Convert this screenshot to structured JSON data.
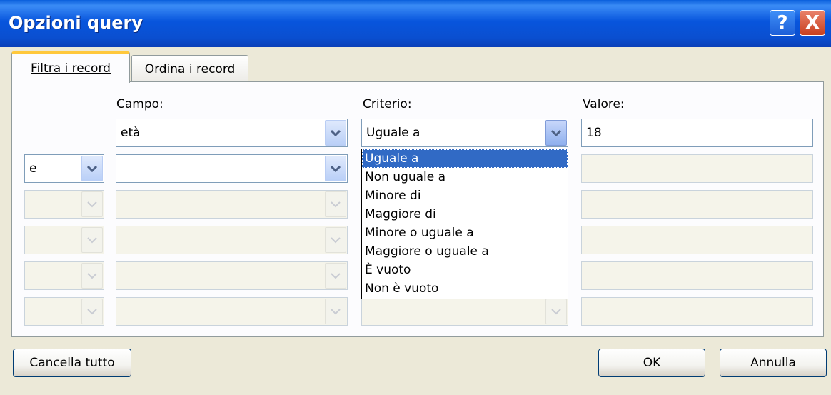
{
  "window": {
    "title": "Opzioni query",
    "help_icon": "?",
    "close_icon": "X"
  },
  "tabs": [
    {
      "label": "Filtra i record"
    },
    {
      "label": "Ordina i record"
    }
  ],
  "headers": {
    "campo": "Campo:",
    "criterio": "Criterio:",
    "valore": "Valore:"
  },
  "rows": [
    {
      "connector": "",
      "campo": "età",
      "criterio": "Uguale a",
      "valore": "18"
    },
    {
      "connector": "e",
      "campo": "",
      "criterio": "",
      "valore": ""
    },
    {
      "connector": "",
      "campo": "",
      "criterio": "",
      "valore": ""
    },
    {
      "connector": "",
      "campo": "",
      "criterio": "",
      "valore": ""
    },
    {
      "connector": "",
      "campo": "",
      "criterio": "",
      "valore": ""
    },
    {
      "connector": "",
      "campo": "",
      "criterio": "",
      "valore": ""
    }
  ],
  "criterio_options": [
    "Uguale a",
    "Non uguale a",
    "Minore di",
    "Maggiore di",
    "Minore o uguale a",
    "Maggiore o uguale a",
    "È vuoto",
    "Non è vuoto"
  ],
  "selected_option_index": 0,
  "buttons": {
    "clear": "Cancella tutto",
    "ok": "OK",
    "cancel": "Annulla"
  },
  "colors": {
    "titlebar": "#0a4fd0",
    "selection": "#316ac5",
    "dialog_bg": "#ece9d8"
  }
}
